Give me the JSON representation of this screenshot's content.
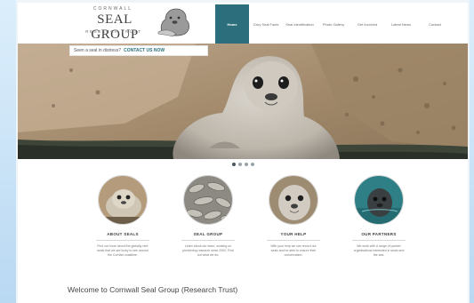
{
  "logo": {
    "top_text": "CORNWALL",
    "main_text": "SEAL GROUP",
    "bottom_text": "RESEARCH TRUST",
    "seal_icon": "hand-holding-seal-logo-icon"
  },
  "tagline": {
    "text": "Seen a seal in distress?",
    "cta": "CONTACT US NOW"
  },
  "nav": {
    "items": [
      {
        "label": "Home",
        "active": true
      },
      {
        "label": "Grey Seal Facts",
        "active": false
      },
      {
        "label": "Seal Identification",
        "active": false
      },
      {
        "label": "Photo Gallery",
        "active": false
      },
      {
        "label": "Get Involved",
        "active": false
      },
      {
        "label": "Latest News",
        "active": false
      },
      {
        "label": "Contact",
        "active": false
      }
    ]
  },
  "slider": {
    "dots": 4,
    "active_dot": 0
  },
  "features": [
    {
      "title": "ABOUT SEALS",
      "text": "Find out more about the globally rare seals that we are lucky to see around the Cornish coastline."
    },
    {
      "title": "SEAL GROUP",
      "text": "Learn about our team, working on pioneering research since 2000. Find out what we do."
    },
    {
      "title": "YOUR HELP",
      "text": "With your help we can record our seals and be able to ensure their conservation."
    },
    {
      "title": "OUR PARTNERS",
      "text": "We work with a range of partner organisations interested in seals and the sea."
    }
  ],
  "welcome": {
    "heading": "Welcome to Cornwall Seal Group (Research Trust)"
  },
  "colors": {
    "accent": "#2c6e7c",
    "page_background": "#cfe6f8"
  }
}
